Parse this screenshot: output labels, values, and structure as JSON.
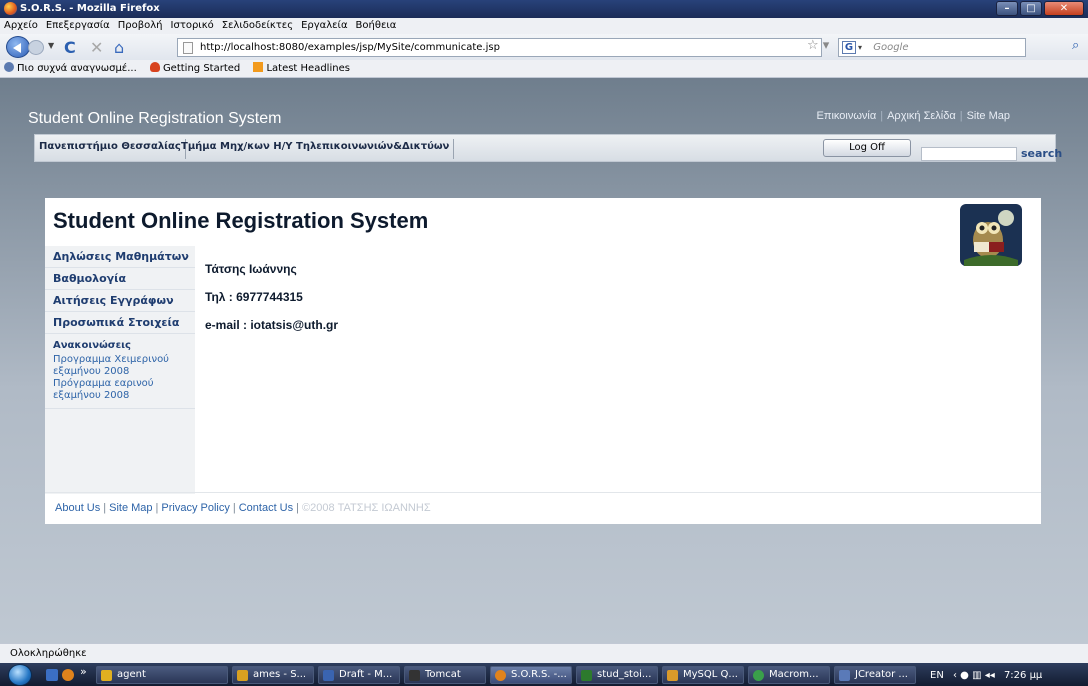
{
  "window": {
    "title": "S.O.R.S. - Mozilla Firefox"
  },
  "menu": [
    "Αρχείο",
    "Επεξεργασία",
    "Προβολή",
    "Ιστορικό",
    "Σελιδοδείκτες",
    "Εργαλεία",
    "Βοήθεια"
  ],
  "nav": {
    "url": "http://localhost:8080/examples/jsp/MySite/communicate.jsp",
    "search_placeholder": "Google"
  },
  "bookmarks": [
    "Πιο συχνά αναγνωσμέ...",
    "Getting Started",
    "Latest Headlines"
  ],
  "site": {
    "title": "Student Online Registration System",
    "toplinks": [
      "Επικοινωνία",
      "Αρχική Σελίδα",
      "Site Map"
    ],
    "tabs": [
      "Πανεπιστήμιο Θεσσαλίας",
      "Τμήμα Μηχ/κων Η/Υ Τηλεπικοινωνιών&Δικτύων"
    ],
    "logoff": "Log Off",
    "search_label": "search"
  },
  "card": {
    "title": "Student Online Registration System",
    "sidebar": [
      "Δηλώσεις Μαθημάτων",
      "Βαθμολογία",
      "Αιτήσεις Εγγράφων",
      "Προσωπικά Στοιχεία"
    ],
    "news_title": "Ανακοινώσεις",
    "news": [
      "Προγραμμα Χειμερινού εξαμήνου 2008",
      "Πρόγραμμα εαρινού εξαμήνου 2008"
    ],
    "contact": {
      "name": "Τάτσης Ιωάννης",
      "phone": "Τηλ : 6977744315",
      "email": "e-mail : iotatsis@uth.gr"
    },
    "footer_links": [
      "About Us",
      "Site Map",
      "Privacy Policy",
      "Contact Us"
    ],
    "copyright": "©2008 ΤΑΤΣΗΣ ΙΩΑΝΝΗΣ"
  },
  "status": "Ολοκληρώθηκε",
  "taskbar": {
    "tasks": [
      "agent",
      "ames - S...",
      "Draft - M...",
      "Tomcat",
      "S.O.R.S. -...",
      "stud_stoi...",
      "MySQL Q...",
      "Macrom...",
      "JCreator ..."
    ],
    "lang": "EN",
    "time": "7:26 μμ"
  },
  "colors": {
    "accent": "#2e64a8",
    "heading": "#1f3d70",
    "page_bg": "#6f7e8d"
  }
}
